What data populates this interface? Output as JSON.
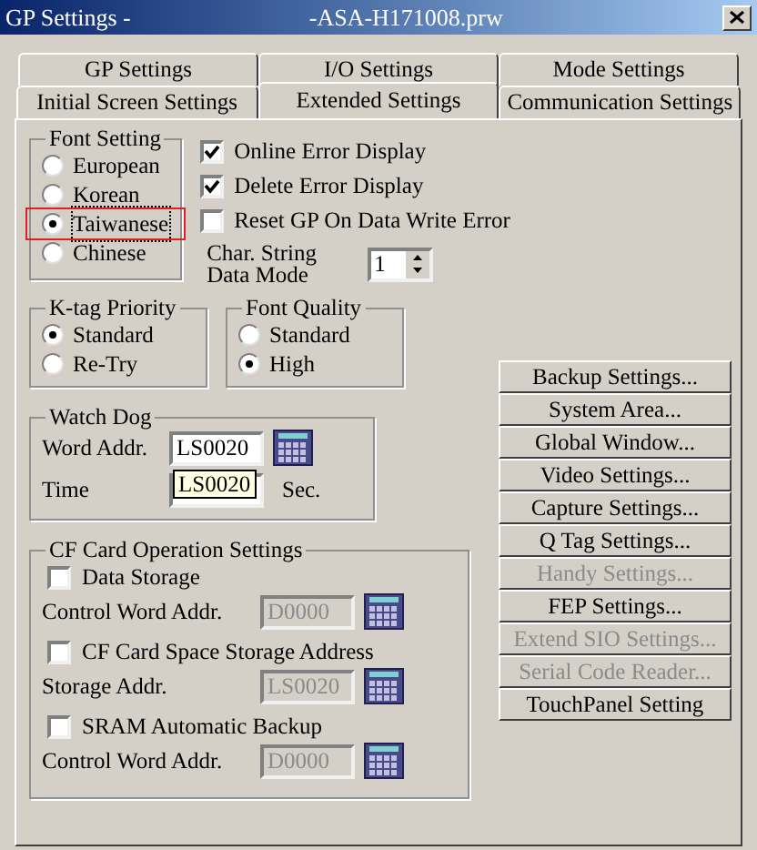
{
  "window": {
    "title": "GP Settings -",
    "file": "-ASA-H171008.prw"
  },
  "tabs_back": [
    {
      "label": "GP Settings",
      "selected": false
    },
    {
      "label": "I/O Settings",
      "selected": false
    },
    {
      "label": "Mode Settings",
      "selected": false
    }
  ],
  "tabs_front": [
    {
      "label": "Initial Screen Settings",
      "selected": false
    },
    {
      "label": "Extended Settings",
      "selected": true
    },
    {
      "label": "Communication Settings",
      "selected": false
    }
  ],
  "font_setting": {
    "title": "Font Setting",
    "options": [
      {
        "label": "European",
        "selected": false,
        "highlighted": false
      },
      {
        "label": "Korean",
        "selected": false,
        "highlighted": false
      },
      {
        "label": "Taiwanese",
        "selected": true,
        "highlighted": true
      },
      {
        "label": "Chinese",
        "selected": false,
        "highlighted": false
      }
    ]
  },
  "checks": [
    {
      "label": "Online Error Display",
      "checked": true
    },
    {
      "label": "Delete Error Display",
      "checked": true
    },
    {
      "label": "Reset GP On Data Write Error",
      "checked": false
    }
  ],
  "char_string": {
    "label": "Char. String Data Mode",
    "value": "1"
  },
  "ktag": {
    "title": "K-tag Priority",
    "options": [
      {
        "label": "Standard",
        "selected": true
      },
      {
        "label": "Re-Try",
        "selected": false
      }
    ]
  },
  "font_quality": {
    "title": "Font Quality",
    "options": [
      {
        "label": "Standard",
        "selected": false
      },
      {
        "label": "High",
        "selected": true
      }
    ]
  },
  "watch_dog": {
    "title": "Watch Dog",
    "word_label": "Word Addr.",
    "word_value": "LS0020",
    "time_label": "Time",
    "unit": "Sec.",
    "tooltip": "LS0020"
  },
  "cf_card": {
    "title": "CF Card Operation Settings",
    "items": [
      {
        "label": "Data Storage",
        "checked": false,
        "addr_label": "Control Word Addr.",
        "addr": "D0000"
      },
      {
        "label": "CF Card Space Storage Address",
        "checked": false,
        "addr_label": "Storage Addr.",
        "addr": "LS0020"
      },
      {
        "label": "SRAM Automatic Backup",
        "checked": false,
        "addr_label": "Control Word Addr.",
        "addr": "D0000"
      }
    ]
  },
  "buttons": [
    {
      "label": "Backup Settings...",
      "disabled": false
    },
    {
      "label": "System Area...",
      "disabled": false
    },
    {
      "label": "Global Window...",
      "disabled": false
    },
    {
      "label": "Video Settings...",
      "disabled": false
    },
    {
      "label": "Capture Settings...",
      "disabled": false
    },
    {
      "label": "Q Tag Settings...",
      "disabled": false
    },
    {
      "label": "Handy Settings...",
      "disabled": true
    },
    {
      "label": "FEP Settings...",
      "disabled": false
    },
    {
      "label": "Extend SIO Settings...",
      "disabled": true
    },
    {
      "label": "Serial Code Reader...",
      "disabled": true
    },
    {
      "label": "TouchPanel Setting",
      "disabled": false
    }
  ]
}
